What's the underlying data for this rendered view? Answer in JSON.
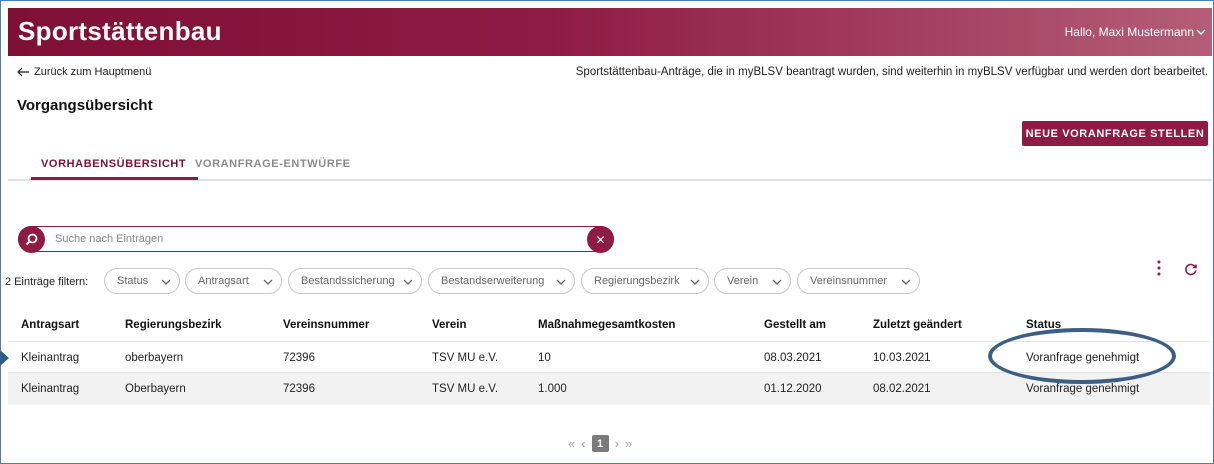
{
  "header": {
    "brand": "Sportstättenbau",
    "greeting": "Hallo, Maxi Mustermann"
  },
  "nav": {
    "back_label": "Zurück zum Hauptmenü",
    "notice": "Sportstättenbau-Anträge, die in myBLSV beantragt wurden, sind weiterhin in myBLSV verfügbar und werden dort bearbeitet."
  },
  "page": {
    "title": "Vorgangsübersicht",
    "new_button": "NEUE VORANFRAGE STELLEN"
  },
  "tabs": [
    {
      "label": "VORHABENSÜBERSICHT",
      "active": true
    },
    {
      "label": "VORANFRAGE-ENTWÜRFE",
      "active": false
    }
  ],
  "search": {
    "placeholder": "Suche nach Einträgen"
  },
  "filters": {
    "label": "2 Einträge filtern:",
    "chips": [
      "Status",
      "Antragsart",
      "Bestandssicherung",
      "Bestandserweiterung",
      "Regierungsbezirk",
      "Verein",
      "Vereinsnummer"
    ]
  },
  "table": {
    "columns": [
      "Antragsart",
      "Regierungsbezirk",
      "Vereinsnummer",
      "Verein",
      "Maßnahmegesamtkosten",
      "Gestellt am",
      "Zuletzt geändert",
      "Status"
    ],
    "rows": [
      [
        "Kleinantrag",
        "oberbayern",
        "72396",
        "TSV MU e.V.",
        "10",
        "08.03.2021",
        "10.03.2021",
        "Voranfrage genehmigt"
      ],
      [
        "Kleinantrag",
        "Oberbayern",
        "72396",
        "TSV MU e.V.",
        "1.000",
        "01.12.2020",
        "08.02.2021",
        "Voranfrage genehmigt"
      ]
    ]
  },
  "pagination": {
    "first": "«",
    "prev": "‹",
    "current": "1",
    "next": "›",
    "last": "»"
  },
  "colors": {
    "brand": "#8e1b43",
    "brand_dark": "#7e0f35",
    "annotation": "#3c5e85"
  }
}
